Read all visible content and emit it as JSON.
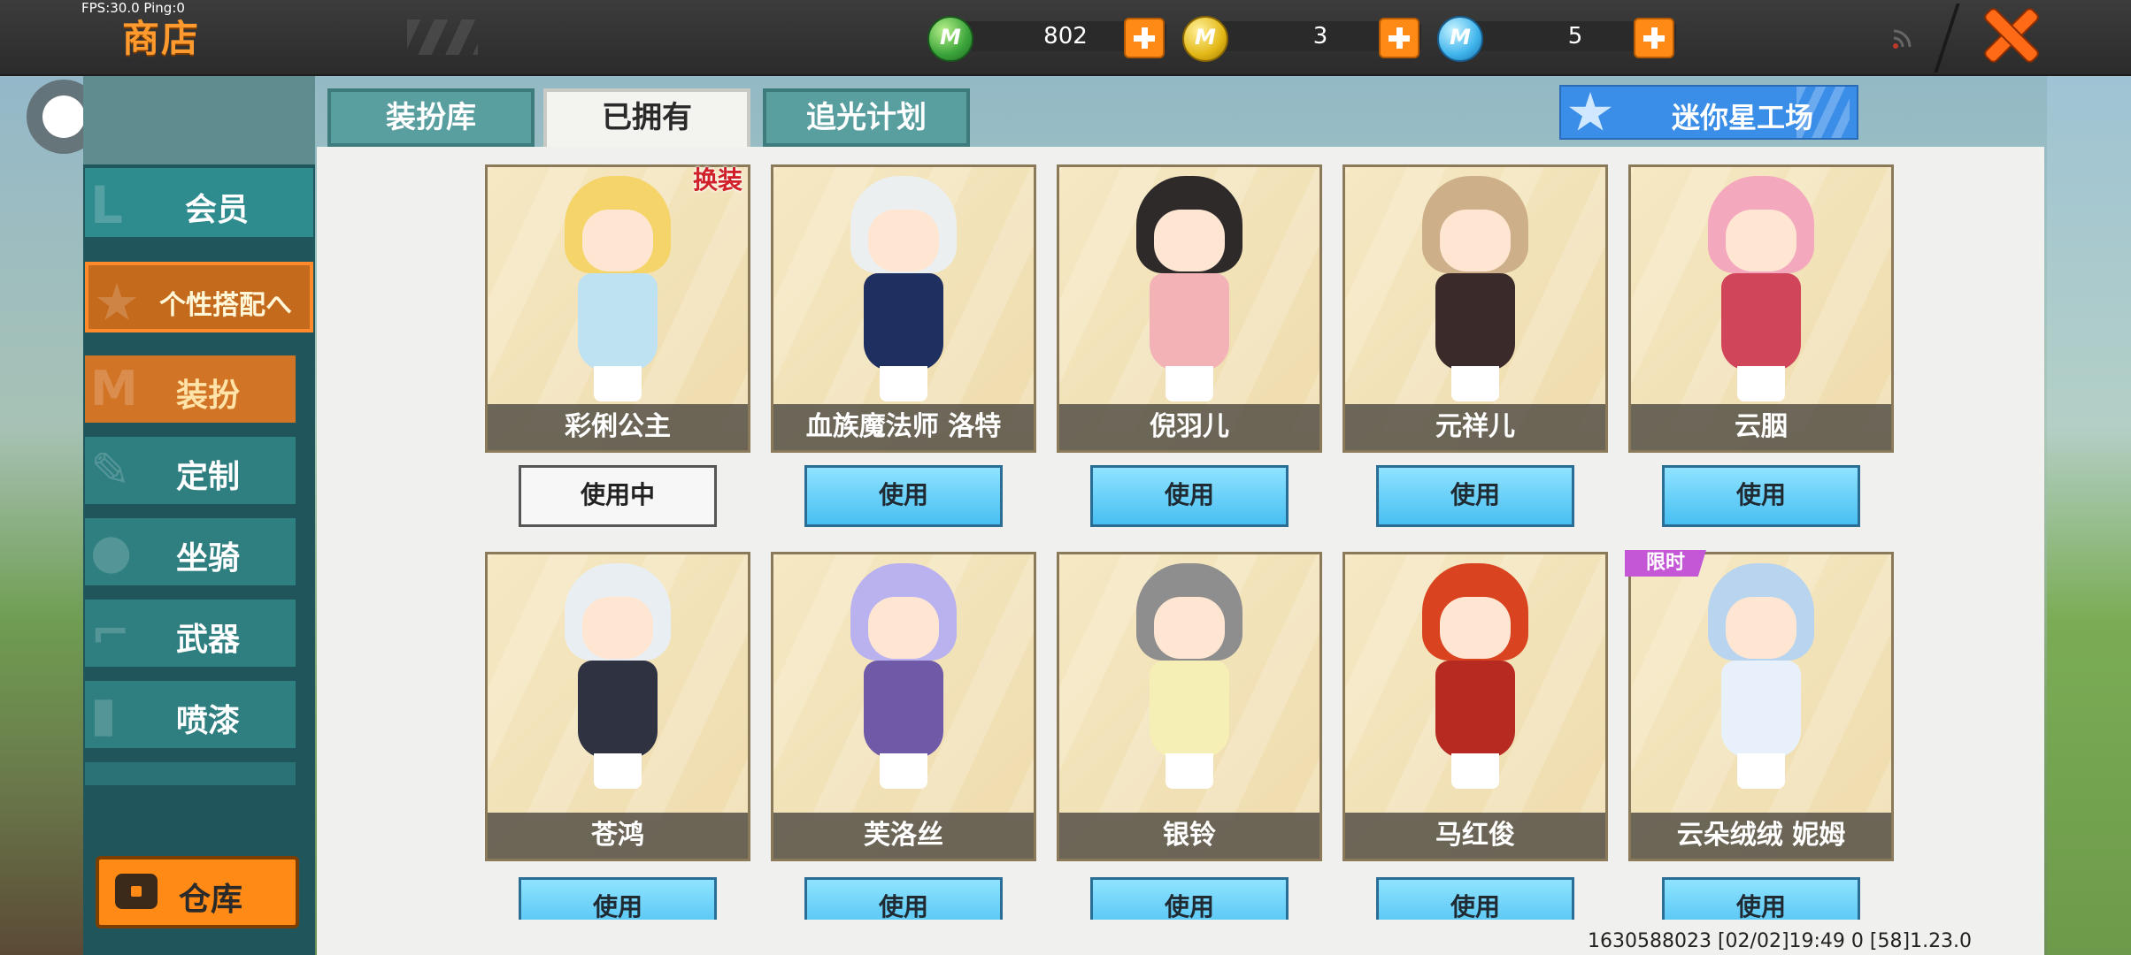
{
  "debug": {
    "fps": "FPS:30.0  Ping:0"
  },
  "header": {
    "title": "商店",
    "currencies": [
      {
        "name": "mini-bean",
        "icon": "green-coin-icon",
        "letter": "M",
        "value": "802"
      },
      {
        "name": "mini-coin",
        "icon": "gold-coin-icon",
        "letter": "M",
        "value": "3"
      },
      {
        "name": "mini-point",
        "icon": "blue-coin-icon",
        "letter": "M",
        "value": "5"
      }
    ]
  },
  "tabs": [
    "装扮库",
    "已拥有",
    "追光计划"
  ],
  "active_tab": "已拥有",
  "mini_workshop_label": "迷你星工场",
  "sidebar": {
    "items": [
      {
        "label": "会员",
        "icon": "L"
      },
      {
        "label": "个性搭配へ",
        "icon": "★"
      },
      {
        "label": "装扮",
        "icon": "M"
      },
      {
        "label": "定制",
        "icon": "✎"
      },
      {
        "label": "坐骑",
        "icon": "●"
      },
      {
        "label": "武器",
        "icon": "⌐"
      },
      {
        "label": "喷漆",
        "icon": "▮"
      }
    ],
    "warehouse_label": "仓库"
  },
  "skins": [
    {
      "name": "彩俐公主",
      "button": "使用中",
      "in_use": true,
      "hair": "#f5d46a",
      "outfit": "#bfe2f2"
    },
    {
      "name": "血族魔法师 洛特",
      "button": "使用",
      "in_use": false,
      "hair": "#eceff0",
      "outfit": "#1f2f5f"
    },
    {
      "name": "倪羽儿",
      "button": "使用",
      "in_use": false,
      "hair": "#2f2a2a",
      "outfit": "#f3b2b6"
    },
    {
      "name": "元祥儿",
      "button": "使用",
      "in_use": false,
      "hair": "#cdb08a",
      "outfit": "#3a2a2a"
    },
    {
      "name": "云胭",
      "button": "使用",
      "in_use": false,
      "hair": "#f4a8bd",
      "outfit": "#d0455a"
    },
    {
      "name": "苍鸿",
      "button": "使用",
      "in_use": false,
      "hair": "#e9eef2",
      "outfit": "#2f3240"
    },
    {
      "name": "芙洛丝",
      "button": "使用",
      "in_use": false,
      "hair": "#b9b2ef",
      "outfit": "#6f5aa8"
    },
    {
      "name": "银铃",
      "button": "使用",
      "in_use": false,
      "hair": "#8e8e8e",
      "outfit": "#f5efb6"
    },
    {
      "name": "马红俊",
      "button": "使用",
      "in_use": false,
      "hair": "#d9431f",
      "outfit": "#b72a22"
    },
    {
      "name": "云朵绒绒 妮姆",
      "button": "使用",
      "in_use": false,
      "hair": "#b9d4ef",
      "outfit": "#e8f1fb"
    }
  ],
  "tags": {
    "limited": "限时",
    "new": "换装"
  },
  "footer": {
    "info": "1630588023  [02/02]19:49 0  [58]1.23.0"
  }
}
